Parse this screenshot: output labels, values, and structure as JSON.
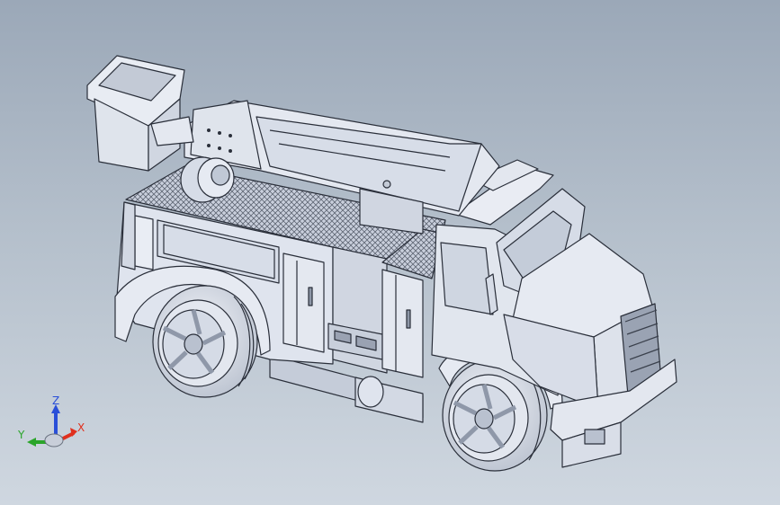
{
  "triad": {
    "x_label": "X",
    "y_label": "Y",
    "z_label": "Z",
    "x_color": "#e0301e",
    "y_color": "#2aa52a",
    "z_color": "#2a4fd8"
  },
  "model": {
    "subject": "bucket-truck-cad-model",
    "body_color": "#dde2ee",
    "shadow_color": "#aab2c4",
    "edge_color": "#2a2f3a"
  }
}
